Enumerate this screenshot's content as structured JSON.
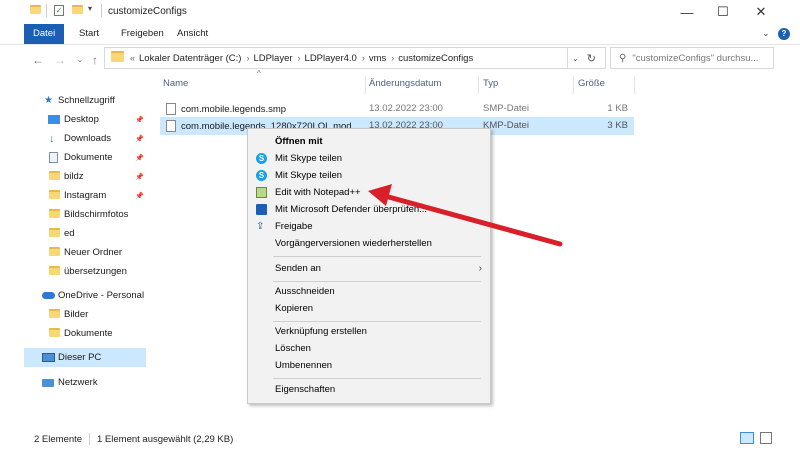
{
  "window": {
    "title": "customizeConfigs",
    "minimize": "—",
    "maximize": "☐",
    "close": "✕"
  },
  "ribbon": {
    "tabs": [
      "Datei",
      "Start",
      "Freigeben",
      "Ansicht"
    ],
    "help": "?"
  },
  "address": {
    "prefix": "«",
    "crumbs": [
      "Lokaler Datenträger (C:)",
      "LDPlayer",
      "LDPlayer4.0",
      "vms",
      "customizeConfigs"
    ],
    "separator": "›"
  },
  "search": {
    "placeholder": "\"customizeConfigs\" durchsu..."
  },
  "nav": {
    "quick_access": "Schnellzugriff",
    "items": [
      {
        "label": "Desktop",
        "icon": "desktop-icon",
        "pinned": true
      },
      {
        "label": "Downloads",
        "icon": "downloads-icon",
        "pinned": true
      },
      {
        "label": "Dokumente",
        "icon": "documents-icon",
        "pinned": true
      },
      {
        "label": "bildz",
        "icon": "folder-icon",
        "pinned": true
      },
      {
        "label": "Instagram",
        "icon": "folder-icon",
        "pinned": true
      },
      {
        "label": "Bildschirmfotos",
        "icon": "folder-icon",
        "pinned": false
      },
      {
        "label": "ed",
        "icon": "folder-icon",
        "pinned": false
      },
      {
        "label": "Neuer Ordner",
        "icon": "folder-icon",
        "pinned": false
      },
      {
        "label": "übersetzungen",
        "icon": "folder-icon",
        "pinned": false
      }
    ],
    "onedrive": "OneDrive - Personal",
    "onedrive_items": [
      "Bilder",
      "Dokumente"
    ],
    "this_pc": "Dieser PC",
    "network": "Netzwerk"
  },
  "columns": {
    "name": "Name",
    "date": "Änderungsdatum",
    "type": "Typ",
    "size": "Größe"
  },
  "files": [
    {
      "name": "com.mobile.legends.smp",
      "date": "13.02.2022 23:00",
      "type": "SMP-Datei",
      "size": "1 KB",
      "selected": false
    },
    {
      "name": "com.mobile.legends_1280x720LOL.mod...",
      "date": "13.02.2022 23:00",
      "type": "KMP-Datei",
      "size": "3 KB",
      "selected": true
    }
  ],
  "context_menu": {
    "open_with": "Öffnen mit",
    "skype1": "Mit Skype teilen",
    "skype2": "Mit Skype teilen",
    "notepad": "Edit with Notepad++",
    "defender": "Mit Microsoft Defender überprüfen...",
    "share": "Freigabe",
    "previous_versions": "Vorgängerversionen wiederherstellen",
    "send_to": "Senden an",
    "cut": "Ausschneiden",
    "copy": "Kopieren",
    "create_shortcut": "Verknüpfung erstellen",
    "delete": "Löschen",
    "rename": "Umbenennen",
    "properties": "Eigenschaften"
  },
  "status": {
    "count": "2 Elemente",
    "selection": "1 Element ausgewählt (2,29 KB)"
  },
  "colors": {
    "accent": "#1a5fb4",
    "selection": "#cce8ff",
    "annotation_arrow": "#d9202a"
  }
}
